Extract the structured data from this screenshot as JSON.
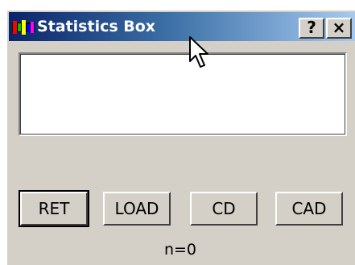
{
  "window": {
    "title": "Statistics Box",
    "caption_buttons": {
      "help_label": "?",
      "close_label": "×"
    }
  },
  "buttons": [
    {
      "label": "RET",
      "is_default": true
    },
    {
      "label": "LOAD"
    },
    {
      "label": "CD"
    },
    {
      "label": "CAD"
    }
  ],
  "status": {
    "count_text": "n=0"
  },
  "colors": {
    "window_face": "#d4d0c8",
    "titlebar_start": "#0a246a",
    "titlebar_end": "#a6caf0",
    "title_text": "#ffffff"
  },
  "icons": {
    "app_icon": "app-icon",
    "cursor": "mouse-pointer-icon"
  }
}
